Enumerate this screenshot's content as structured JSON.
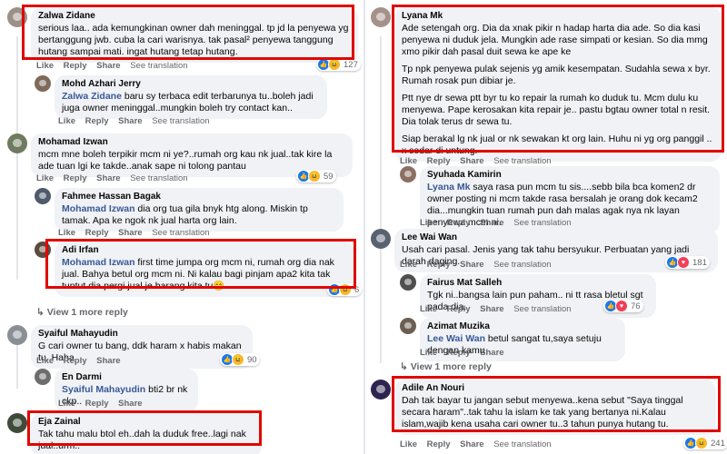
{
  "actions": {
    "like": "Like",
    "reply": "Reply",
    "share": "Share",
    "see_translation": "See translation"
  },
  "left": {
    "c1": {
      "author": "Zalwa Zidane",
      "text": "serious laa.. ada kemungkinan owner dah meninggal. tp jd la penyewa yg bertanggung jwb. cuba la cari warisnya. tak pasal² penyewa tanggung hutang sampai mati. ingat hutang tetap hutang.",
      "count": "127"
    },
    "c2": {
      "author": "Mohd Azhari Jerry",
      "tag": "Zalwa Zidane",
      "text": " baru sy terbaca edit terbarunya tu..boleh jadi juga owner meninggal..mungkin boleh try contact kan.."
    },
    "c3": {
      "author": "Mohamad Izwan",
      "text": "mcm mne boleh terpikir mcm ni ye?..rumah org kau nk jual..tak kire la ade tuan lgi ke takde..anak sape ni tolong pantau",
      "count": "59"
    },
    "c4": {
      "author": "Fahmee Hassan Bagak",
      "tag": "Mohamad Izwan",
      "text": " dia org tua gila bnyk htg along. Miskin tp tamak. Apa ke ngok nk jual harta org lain."
    },
    "c5": {
      "author": "Adi Irfan",
      "tag": "Mohamad Izwan",
      "text": " first time jumpa org mcm ni, rumah org dia nak jual. Bahya betul org mcm ni. Ni kalau bagi pinjam apa2 kita tak tuntut dia pergi jual je barang kita tu😄",
      "count": "6"
    },
    "view_more": "View 1 more reply",
    "c6": {
      "author": "Syaiful Mahayudin",
      "text": "G cari owner tu bang, ddk haram x habis makan tu. Haha",
      "count": "90"
    },
    "c7": {
      "author": "En Darmi",
      "tag": "Syaiful Mahayudin",
      "text": " bti2 br nk ckp.."
    },
    "c8": {
      "author": "Eja Zainal",
      "text": "Tak tahu malu btol eh..dah la duduk free..lagi nak jual..urm.."
    }
  },
  "right": {
    "c1": {
      "author": "Lyana Mk",
      "paragraphs": [
        "Ade setengah org. Dia da xnak pikir n hadap harta dia ade. So dia kasi penyewa ni duduk jela. Mungkin ade rase simpati or kesian. So dia mmg xmo pikir dah pasal duit sewa ke ape ke",
        "Tp npk penyewa pulak sejenis yg amik kesempatan. Sudahla sewa x byr. Rumah rosak pun dibiar je.",
        "Ptt nye dr sewa ptt byr tu ko repair la rumah ko duduk tu. Mcm dulu ku menyewa. Pape kerosakan kita repair je.. pastu bgtau owner total n resit. Dia tolak terus dr sewa tu.",
        "Siap berakal lg nk jual or nk sewakan kt org lain. Huhu ni yg org panggil .. x sedar di untung."
      ]
    },
    "c2": {
      "author": "Syuhada Kamirin",
      "tag": "Lyana Mk",
      "text": " saya rasa pun mcm tu sis....sebb bila bca komen2 dr owner posting ni mcm takde rasa bersalah je orang dok kecam2 dia...mungkin tuan rumah pun dah malas agak nya nk layan penyewa mcm ni."
    },
    "c3": {
      "author": "Lee Wai Wan",
      "text": "Usah cari pasal. Jenis yang tak tahu bersyukur. Perbuatan yang jadi darah daging.",
      "count": "181"
    },
    "c4": {
      "author": "Fairus Mat Salleh",
      "text": "Tgk ni..bangsa lain pun paham.. ni tt rasa bletul sgt pada dia.",
      "count": "76"
    },
    "c5": {
      "author": "Azimat Muzika",
      "tag": "Lee Wai Wan",
      "text": " betul sangat tu,saya setuju dengan kamu"
    },
    "view_more": "View 1 more reply",
    "c6": {
      "author": "Adile An Nouri",
      "text": "Dah tak bayar tu jangan sebut menyewa..kena sebut \"Saya tinggal secara haram\"..tak tahu la islam ke tak yang bertanya ni.Kalau islam,wajib kena usaha cari owner tu..3 tahun punya hutang tu.",
      "count": "241"
    }
  },
  "colors": {
    "highlight": "#e10600",
    "bubble": "#f0f2f5",
    "meta": "#65676b",
    "tag": "#385898",
    "like": "#1877f2"
  }
}
